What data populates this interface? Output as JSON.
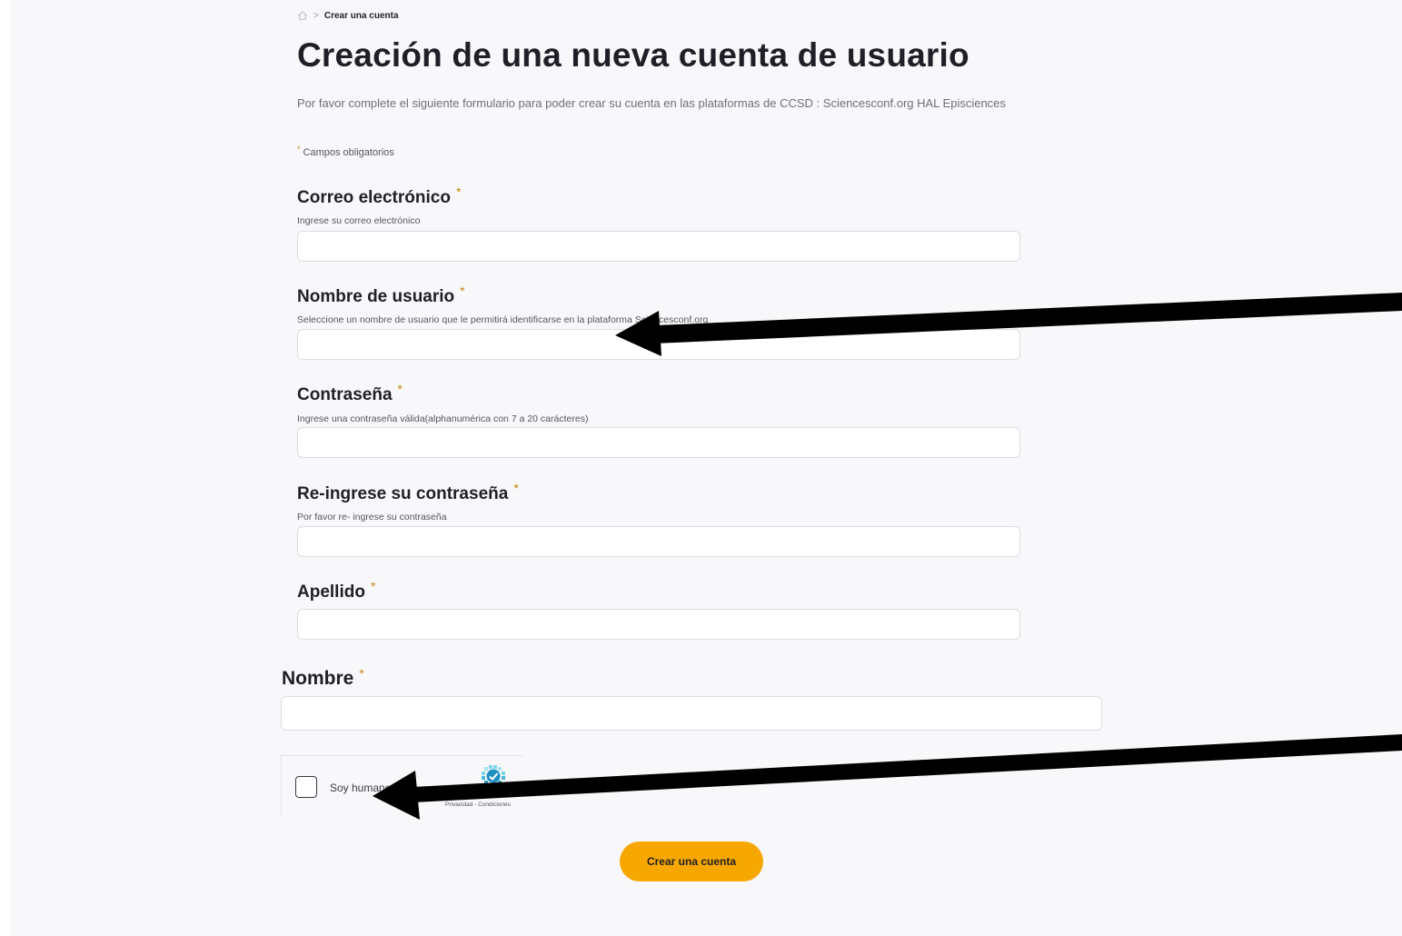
{
  "breadcrumb": {
    "home_icon": "home-icon",
    "separator": ">",
    "current": "Crear una cuenta"
  },
  "title": "Creación de una nueva cuenta de usuario",
  "intro": "Por favor complete el siguiente formulario para poder crear su cuenta en las plataformas de CCSD : Sciencesconf.org HAL Episciences",
  "required_note": {
    "asterisk": "*",
    "text": "Campos obligatorios"
  },
  "fields": {
    "email": {
      "label": "Correo electrónico",
      "required": "*",
      "help": "Ingrese su correo electrónico",
      "value": ""
    },
    "username": {
      "label": "Nombre de usuario",
      "required": "*",
      "help": "Seleccione un nombre de usuario que le permitirá identificarse en la plataforma Sciencesconf.org",
      "value": ""
    },
    "password": {
      "label": "Contraseña",
      "required": "*",
      "help": "Ingrese una contraseña válida(alphanumérica con 7 a 20 carácteres)",
      "value": ""
    },
    "password_confirm": {
      "label": "Re-ingrese su contraseña",
      "required": "*",
      "help": "Por favor re- ingrese su contraseña",
      "value": ""
    },
    "lastname": {
      "label": "Apellido",
      "required": "*",
      "value": ""
    },
    "firstname": {
      "label": "Nombre",
      "required": "*",
      "value": ""
    }
  },
  "captcha": {
    "label": "Soy humano",
    "links": "Privacidad - Condiciones",
    "logo_icon": "hcaptcha-logo-icon",
    "checked": false
  },
  "submit": {
    "label": "Crear una cuenta"
  },
  "colors": {
    "accent": "#f7a800",
    "required_asterisk": "#c48a12",
    "page_background": "#f8f8fa"
  },
  "annotations": {
    "arrows": 2,
    "color": "#000000"
  }
}
